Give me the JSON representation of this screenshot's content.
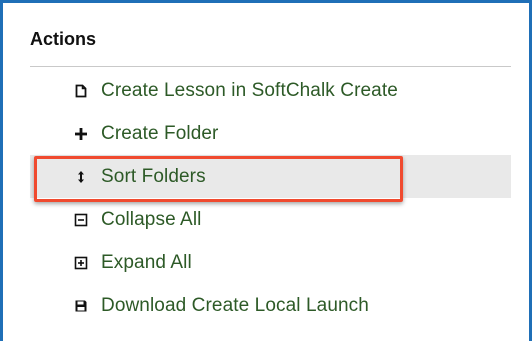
{
  "panel": {
    "title": "Actions"
  },
  "menu": {
    "items": [
      {
        "label": "Create Lesson in SoftChalk Create",
        "icon": "document-icon"
      },
      {
        "label": "Create Folder",
        "icon": "plus-icon"
      },
      {
        "label": "Sort Folders",
        "icon": "sort-arrows-icon",
        "selected": true
      },
      {
        "label": "Collapse All",
        "icon": "collapse-icon"
      },
      {
        "label": "Expand All",
        "icon": "expand-icon"
      },
      {
        "label": "Download Create Local Launch",
        "icon": "save-icon"
      }
    ]
  },
  "colors": {
    "frame": "#1f6fb7",
    "link_text": "#2d5a27",
    "highlight_box": "#f04a2f",
    "selected_row": "#e9e9e9"
  }
}
